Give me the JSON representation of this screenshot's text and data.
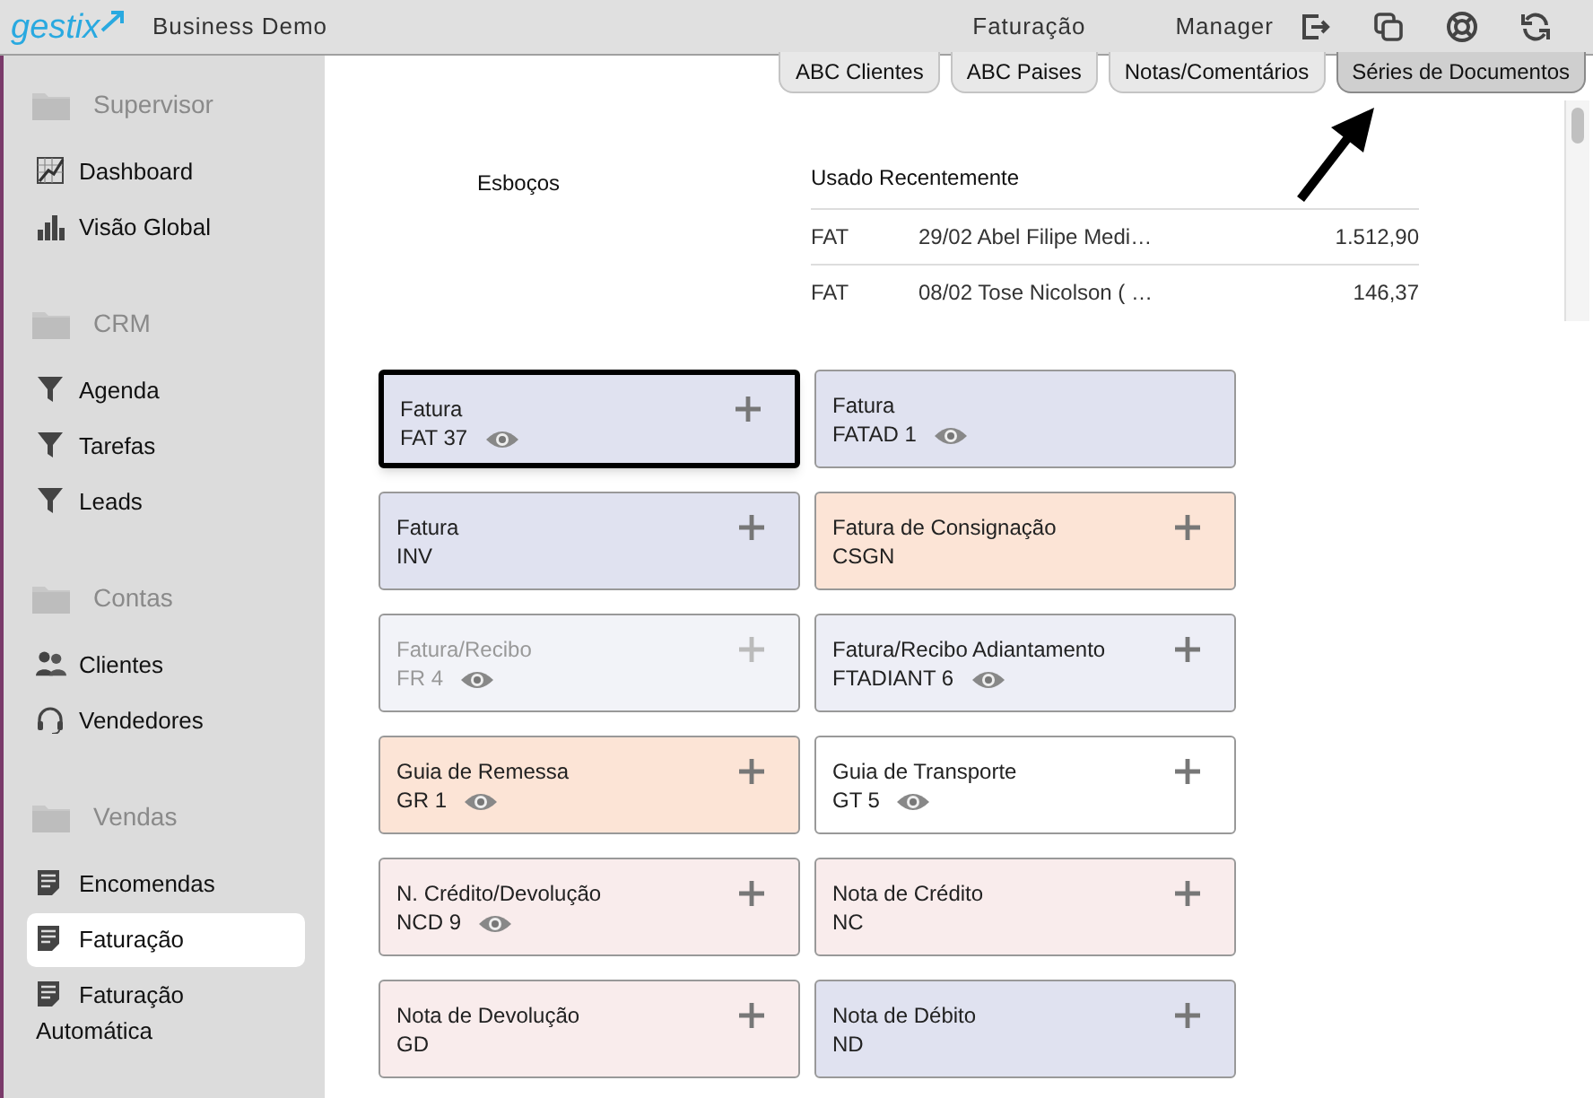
{
  "header": {
    "logo": "gestix",
    "company": "Business Demo",
    "section": "Faturação",
    "user": "Manager"
  },
  "tabs": [
    {
      "label": "ABC Clientes",
      "selected": false
    },
    {
      "label": "ABC Paises",
      "selected": false
    },
    {
      "label": "Notas/Comentários",
      "selected": false
    },
    {
      "label": "Séries de Documentos",
      "selected": true
    }
  ],
  "sidebar": {
    "groups": [
      {
        "title": "Supervisor",
        "items": [
          {
            "label": "Dashboard",
            "selected": false
          },
          {
            "label": "Visão Global",
            "selected": false
          }
        ]
      },
      {
        "title": "CRM",
        "items": [
          {
            "label": "Agenda",
            "selected": false
          },
          {
            "label": "Tarefas",
            "selected": false
          },
          {
            "label": "Leads",
            "selected": false
          }
        ]
      },
      {
        "title": "Contas",
        "items": [
          {
            "label": "Clientes",
            "selected": false
          },
          {
            "label": "Vendedores",
            "selected": false
          }
        ]
      },
      {
        "title": "Vendas",
        "items": [
          {
            "label": "Encomendas",
            "selected": false
          },
          {
            "label": "Faturação",
            "selected": true
          },
          {
            "label": "Faturação Automática",
            "selected": false
          }
        ]
      }
    ]
  },
  "drafts": {
    "title": "Esboços"
  },
  "recent": {
    "title": "Usado Recentemente",
    "rows": [
      {
        "type": "FAT",
        "description": "29/02 Abel Filipe Medi…",
        "amount": "1.512,90"
      },
      {
        "type": "FAT",
        "description": "08/02 Tose Nicolson ( …",
        "amount": "146,37"
      }
    ]
  },
  "series": [
    {
      "name": "Fatura",
      "code": "FAT 37",
      "color": "#e0e2f0",
      "selected": true,
      "disabled": false,
      "preview": true,
      "addable": true
    },
    {
      "name": "Fatura",
      "code": "FATAD 1",
      "color": "#e0e2f0",
      "selected": false,
      "disabled": false,
      "preview": true,
      "addable": false
    },
    {
      "name": "Fatura",
      "code": "INV",
      "color": "#e0e2f0",
      "selected": false,
      "disabled": false,
      "preview": false,
      "addable": true
    },
    {
      "name": "Fatura de Consignação",
      "code": "CSGN",
      "color": "#fce4d6",
      "selected": false,
      "disabled": false,
      "preview": false,
      "addable": true
    },
    {
      "name": "Fatura/Recibo",
      "code": "FR 4",
      "color": "#f2f3f8",
      "selected": false,
      "disabled": true,
      "preview": true,
      "addable": true
    },
    {
      "name": "Fatura/Recibo Adiantamento",
      "code": "FTADIANT 6",
      "color": "#edeef6",
      "selected": false,
      "disabled": false,
      "preview": true,
      "addable": true
    },
    {
      "name": "Guia de Remessa",
      "code": "GR 1",
      "color": "#fce4d6",
      "selected": false,
      "disabled": false,
      "preview": true,
      "addable": true
    },
    {
      "name": "Guia de Transporte",
      "code": "GT 5",
      "color": "#ffffff",
      "selected": false,
      "disabled": false,
      "preview": true,
      "addable": true
    },
    {
      "name": "N. Crédito/Devolução",
      "code": "NCD 9",
      "color": "#f9ecec",
      "selected": false,
      "disabled": false,
      "preview": true,
      "addable": true
    },
    {
      "name": "Nota de Crédito",
      "code": "NC",
      "color": "#f9ecec",
      "selected": false,
      "disabled": false,
      "preview": false,
      "addable": true
    },
    {
      "name": "Nota de Devolução",
      "code": "GD",
      "color": "#f9ecec",
      "selected": false,
      "disabled": false,
      "preview": false,
      "addable": true
    },
    {
      "name": "Nota de Débito",
      "code": "ND",
      "color": "#e0e2f0",
      "selected": false,
      "disabled": false,
      "preview": false,
      "addable": true
    }
  ]
}
